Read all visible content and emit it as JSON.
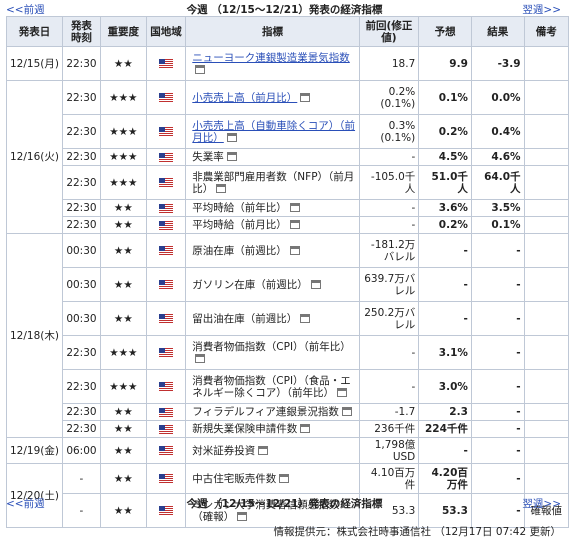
{
  "nav": {
    "prev": "<<前週",
    "next": "翌週>>",
    "title": "今週 （12/15～12/21）発表の経済指標"
  },
  "headers": {
    "date": "発表日",
    "time": "発表時刻",
    "importance": "重要度",
    "country": "国地域",
    "indicator": "指標",
    "previous": "前回(修正値)",
    "forecast": "予想",
    "result": "結果",
    "notes": "備考"
  },
  "dates": {
    "d1215": "12/15(月)",
    "d1216": "12/16(火)",
    "d1218": "12/18(木)",
    "d1219": "12/19(金)",
    "d1220": "12/20(土)"
  },
  "rows": [
    {
      "time": "22:30",
      "stars": "★★",
      "indicator": "ニューヨーク連銀製造業景気指数",
      "linked": true,
      "previous": "18.7",
      "forecast": "9.9",
      "result": "-3.9",
      "note": ""
    },
    {
      "time": "22:30",
      "stars": "★★★",
      "indicator": "小売売上高（前月比）",
      "linked": true,
      "previous": "0.2%\n(0.1%)",
      "forecast": "0.1%",
      "result": "0.0%",
      "note": ""
    },
    {
      "time": "22:30",
      "stars": "★★★",
      "indicator": "小売売上高（自動車除くコア）（前月比）",
      "linked": true,
      "previous": "0.3%\n(0.1%)",
      "forecast": "0.2%",
      "result": "0.4%",
      "note": ""
    },
    {
      "time": "22:30",
      "stars": "★★★",
      "indicator": "失業率",
      "linked": false,
      "previous": "-",
      "forecast": "4.5%",
      "result": "4.6%",
      "note": ""
    },
    {
      "time": "22:30",
      "stars": "★★★",
      "indicator": "非農業部門雇用者数（NFP）（前月比）",
      "linked": false,
      "previous": "-105.0千人",
      "forecast": "51.0千人",
      "result": "64.0千人",
      "note": ""
    },
    {
      "time": "22:30",
      "stars": "★★",
      "indicator": "平均時給（前年比）",
      "linked": false,
      "previous": "-",
      "forecast": "3.6%",
      "result": "3.5%",
      "note": ""
    },
    {
      "time": "22:30",
      "stars": "★★",
      "indicator": "平均時給（前月比）",
      "linked": false,
      "previous": "-",
      "forecast": "0.2%",
      "result": "0.1%",
      "note": ""
    },
    {
      "time": "00:30",
      "stars": "★★",
      "indicator": "原油在庫（前週比）",
      "linked": false,
      "previous": "-181.2万バレル",
      "forecast": "-",
      "result": "-",
      "note": ""
    },
    {
      "time": "00:30",
      "stars": "★★",
      "indicator": "ガソリン在庫（前週比）",
      "linked": false,
      "previous": "639.7万バレル",
      "forecast": "-",
      "result": "-",
      "note": ""
    },
    {
      "time": "00:30",
      "stars": "★★",
      "indicator": "留出油在庫（前週比）",
      "linked": false,
      "previous": "250.2万バレル",
      "forecast": "-",
      "result": "-",
      "note": ""
    },
    {
      "time": "22:30",
      "stars": "★★★",
      "indicator": "消費者物価指数（CPI）（前年比）",
      "linked": false,
      "previous": "-",
      "forecast": "3.1%",
      "result": "-",
      "note": ""
    },
    {
      "time": "22:30",
      "stars": "★★★",
      "indicator": "消費者物価指数（CPI）（食品・エネルギー除くコア）（前年比）",
      "linked": false,
      "previous": "-",
      "forecast": "3.0%",
      "result": "-",
      "note": ""
    },
    {
      "time": "22:30",
      "stars": "★★",
      "indicator": "フィラデルフィア連銀景況指数",
      "linked": false,
      "previous": "-1.7",
      "forecast": "2.3",
      "result": "-",
      "note": ""
    },
    {
      "time": "22:30",
      "stars": "★★",
      "indicator": "新規失業保険申請件数",
      "linked": false,
      "previous": "236千件",
      "forecast": "224千件",
      "result": "-",
      "note": ""
    },
    {
      "time": "06:00",
      "stars": "★★",
      "indicator": "対米証券投資",
      "linked": false,
      "previous": "1,798億USD",
      "forecast": "-",
      "result": "-",
      "note": ""
    },
    {
      "time": "-",
      "stars": "★★",
      "indicator": "中古住宅販売件数",
      "linked": false,
      "previous": "4.10百万件",
      "forecast": "4.20百万件",
      "result": "-",
      "note": ""
    },
    {
      "time": "-",
      "stars": "★★",
      "indicator": "ミシガン大学消費者信頼感指数（確報）",
      "linked": false,
      "previous": "53.3",
      "forecast": "53.3",
      "result": "-",
      "note": "確報値"
    }
  ],
  "footer": "情報提供元：株式会社時事通信社 （12月17日 07:42 更新）",
  "icons": {
    "flag": "us-flag-icon",
    "window": "popup-window-icon"
  }
}
